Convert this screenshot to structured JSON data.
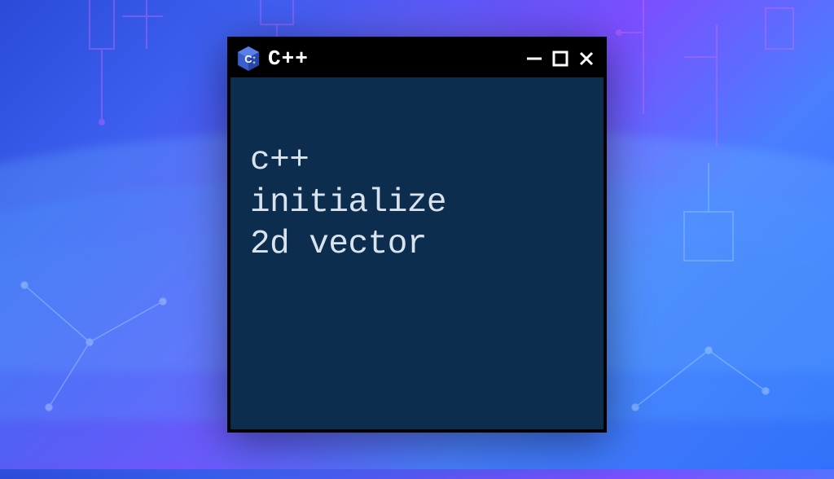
{
  "window": {
    "title": "C++",
    "body_text": "c++\ninitialize\n2d vector",
    "icons": {
      "app": "cpp-logo",
      "minimize": "minimize-icon",
      "maximize": "maximize-icon",
      "close": "close-icon"
    },
    "colors": {
      "body_bg": "#0d2d4f",
      "border": "#000000",
      "text": "#d9e3ee"
    }
  }
}
